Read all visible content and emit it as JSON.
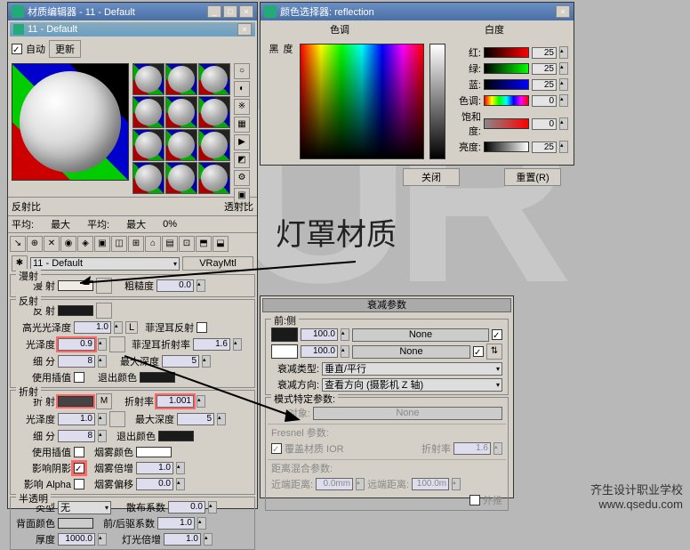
{
  "bg_letters": "UR",
  "annotation": "灯罩材质",
  "watermark": "齐生设计职业学校\nwww.qsedu.com",
  "mat": {
    "title": "材质编辑器 - 11 - Default",
    "subtitle": "11 - Default",
    "auto": "自动",
    "update": "更新",
    "sect_balance": {
      "reflect": "反射比",
      "transmit": "透射比",
      "avg": "平均:",
      "max": "最大",
      "zero": "0%"
    },
    "toolbar_name": "11 - Default",
    "mtl_type": "VRayMtl",
    "diffuse": {
      "grp": "漫射",
      "label": "漫 射",
      "rough": "粗糙度",
      "rough_v": "0.0"
    },
    "reflect": {
      "grp": "反射",
      "label": "反 射",
      "hilight": "高光光泽度",
      "hilight_v": "1.0",
      "l": "L",
      "fresnel": "菲涅耳反射",
      "gloss": "光泽度",
      "gloss_v": "0.9",
      "fior": "菲涅耳折射率",
      "fior_v": "1.6",
      "sub": "细 分",
      "sub_v": "8",
      "depth": "最大深度",
      "depth_v": "5",
      "interp": "使用插值",
      "exit": "退出颜色"
    },
    "refract": {
      "grp": "折射",
      "label": "折 射",
      "ior": "折射率",
      "ior_v": "1.001",
      "gloss": "光泽度",
      "gloss_v": "1.0",
      "depth": "最大深度",
      "depth_v": "5",
      "sub": "细 分",
      "sub_v": "8",
      "exit": "退出颜色",
      "interp": "使用插值",
      "fogc": "烟雾颜色",
      "shadow": "影响阴影",
      "fogm": "烟雾倍增",
      "fogm_v": "1.0",
      "alpha": "影响 Alpha",
      "fogb": "烟雾偏移",
      "fogb_v": "0.0"
    },
    "trans": {
      "grp": "半透明",
      "type": "类型",
      "type_v": "无",
      "scatter": "散布系数",
      "scatter_v": "0.0",
      "back": "背面颜色",
      "fb": "前/后驱系数",
      "fb_v": "1.0",
      "thick": "厚度",
      "thick_v": "1000.0",
      "light": "灯光倍增",
      "light_v": "1.0"
    }
  },
  "color": {
    "title": "颜色选择器: reflection",
    "hue": "色调",
    "white": "白度",
    "black": "黑\n度",
    "r": "红:",
    "r_v": "25",
    "g": "绿:",
    "g_v": "25",
    "b": "蓝:",
    "b_v": "25",
    "h": "色调:",
    "h_v": "0",
    "s": "饱和度:",
    "s_v": "0",
    "v": "亮度:",
    "v_v": "25",
    "close": "关闭",
    "reset": "重置(R)"
  },
  "falloff": {
    "title": "衰减参数",
    "front": "前:侧",
    "v1": "100.0",
    "v2": "100.0",
    "none": "None",
    "type": "衰减类型:",
    "type_v": "垂直/平行",
    "dir": "衰减方向:",
    "dir_v": "查看方向 (摄影机 Z 轴)",
    "mode": "模式特定参数:",
    "obj": "对象:",
    "fresnel": "Fresnel 参数:",
    "override": "覆盖材质 IOR",
    "ior": "折射率",
    "ior_v": "1.6",
    "dist": "距离混合参数:",
    "near": "近端距离:",
    "near_v": "0.0mm",
    "far": "远端距离:",
    "far_v": "100.0m",
    "extrap": "外推"
  }
}
